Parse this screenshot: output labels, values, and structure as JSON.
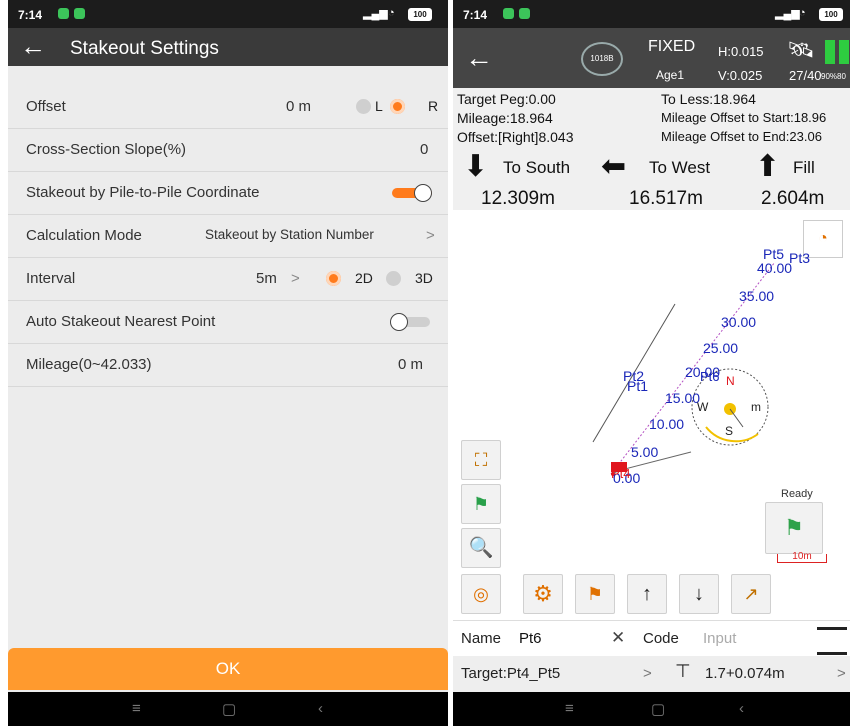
{
  "left": {
    "status": {
      "time": "7:14",
      "battery": "100"
    },
    "header": {
      "title": "Stakeout Settings"
    },
    "rows": {
      "offset": {
        "label": "Offset",
        "value": "0 m",
        "opt_l": "L",
        "opt_r": "R",
        "selected": "R"
      },
      "slope": {
        "label": "Cross-Section Slope(%)",
        "value": "0"
      },
      "pile": {
        "label": "Stakeout by Pile-to-Pile Coordinate",
        "on": true
      },
      "calc": {
        "label": "Calculation Mode",
        "value": "Stakeout by Station Number",
        "chevron": ">"
      },
      "interval": {
        "label": "Interval",
        "value": "5m",
        "chevron": ">",
        "opt_2d": "2D",
        "opt_3d": "3D",
        "selected": "2D"
      },
      "auto": {
        "label": "Auto Stakeout Nearest Point",
        "on": false
      },
      "mileage": {
        "label": "Mileage(0~42.033)",
        "value": "0 m"
      }
    },
    "ok_label": "OK"
  },
  "right": {
    "status": {
      "time": "7:14",
      "battery": "100"
    },
    "topbar": {
      "circle_label": "1018B",
      "fix": "FIXED",
      "age": "Age1",
      "h": "H:0.015",
      "v": "V:0.025",
      "sats": "27/40",
      "batt_pct": "90%80"
    },
    "info": {
      "target_peg": "Target Peg:0.00",
      "to_less": "To Less:18.964",
      "mileage": "Mileage:18.964",
      "offset_start": "Mileage Offset to Start:18.96",
      "offset": "Offset:[Right]8.043",
      "offset_end": "Mileage Offset to End:23.06"
    },
    "dirs": {
      "south_label": "To South",
      "south_val": "12.309m",
      "west_label": "To West",
      "west_val": "16.517m",
      "fill_label": "Fill",
      "fill_val": "2.604m"
    },
    "map": {
      "labels": {
        "pt5": "Pt5",
        "pt3": "Pt3",
        "s40": "40.00",
        "s35": "35.00",
        "s30": "30.00",
        "s25": "25.00",
        "pt2": "Pt2",
        "pt1": "Pt1",
        "s20": "20.00",
        "pt6": "Pt6",
        "s15": "15.00",
        "s10": "10.00",
        "s5": "5.00",
        "s0": "0.00",
        "pt4": "Pt4",
        "compass_n": "N",
        "compass_w": "W",
        "compass_s": "S",
        "compass_m": "m",
        "ready": "Ready",
        "scale": "10m"
      }
    },
    "name_row": {
      "name_label": "Name",
      "name_value": "Pt6",
      "clear": "✕",
      "code_label": "Code",
      "code_placeholder": "Input"
    },
    "target_row": {
      "target": "Target:Pt4_Pt5",
      "chevron": ">",
      "height": "1.7+0.074m",
      "chevron2": ">"
    }
  }
}
